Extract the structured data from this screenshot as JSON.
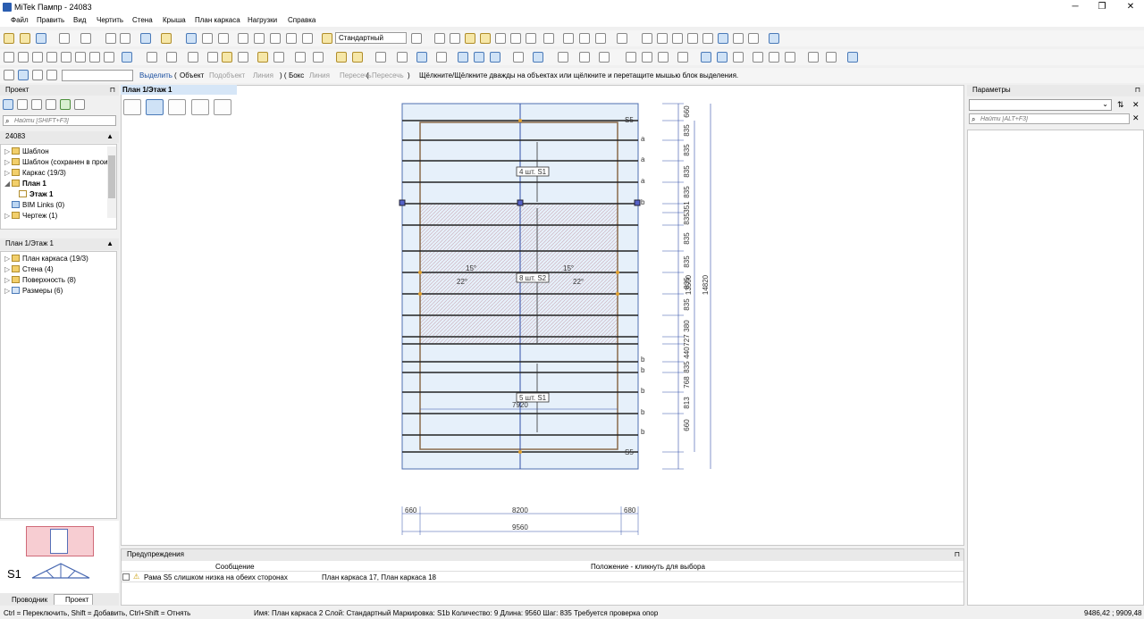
{
  "window": {
    "title": "MiTek Пампр - 24083",
    "minimize": "─",
    "maximize": "❐",
    "close": "✕"
  },
  "menu": [
    "Файл",
    "Править",
    "Вид",
    "Чертить",
    "Стена",
    "Крыша",
    "План каркаса",
    "Нагрузки",
    "Справка"
  ],
  "toolbar": {
    "layer_combo": "Стандартный"
  },
  "selection_bar": {
    "select_label": "Выделить",
    "object": "Объект",
    "subobject": "Подобъект",
    "line": "Линия",
    "box": "Бокс",
    "fence": "Линия",
    "crossing": "Пересечь",
    "between": "Пересечь",
    "hint": "Щёлкните/Щёлкните дважды на объектах или щёлкните и перетащите мышью блок выделения."
  },
  "project_panel": {
    "title": "Проект",
    "search_placeholder": "Найти [SHIFT+F3]",
    "project_name": "24083",
    "items": [
      {
        "label": "Шаблон",
        "level": 0
      },
      {
        "label": "Шаблон (сохранен в проиэ",
        "level": 0
      },
      {
        "label": "Каркас (19/3)",
        "level": 0
      },
      {
        "label": "План 1",
        "level": 0,
        "bold": true
      },
      {
        "label": "Этаж 1",
        "level": 1,
        "bold": true
      },
      {
        "label": "BIM Links (0)",
        "level": 0
      },
      {
        "label": "Чертеж (1)",
        "level": 0
      }
    ]
  },
  "floor_panel": {
    "title": "План 1/Этаж 1",
    "items": [
      {
        "label": "План каркаса (19/3)"
      },
      {
        "label": "Стена (4)"
      },
      {
        "label": "Поверхность (8)"
      },
      {
        "label": "Размеры (6)"
      }
    ]
  },
  "preview": {
    "label": "S1"
  },
  "left_tabs": {
    "explorer": "Проводник",
    "project": "Проект"
  },
  "doc_tab": "План 1/Этаж 1",
  "drawing": {
    "labels": {
      "s5_top": "S5",
      "s5_bottom": "S5",
      "group1": "4 шт. S1",
      "group2": "8 шт. S2",
      "group3": "5 шт. S1",
      "inner_width": "7920",
      "angle_left_top": "15°",
      "angle_left_bottom": "22°",
      "angle_right_top": "15°",
      "angle_right_bottom": "22°"
    },
    "row_tags_a": [
      "a",
      "a",
      "a",
      "b"
    ],
    "row_tags_b": [
      "b",
      "b",
      "b",
      "b",
      "b"
    ],
    "right_dims": [
      "660",
      "835",
      "835",
      "835",
      "835",
      "351",
      "835",
      "835",
      "835",
      "835",
      "835",
      "380",
      "727",
      "440",
      "835",
      "768",
      "813",
      "660"
    ],
    "dim_total_inner": "13500",
    "dim_total": "14820",
    "bottom_dims": [
      "660",
      "8200",
      "680"
    ],
    "bottom_total": "9560"
  },
  "params_panel": {
    "title": "Параметры",
    "search_placeholder": "Найти [ALT+F3]"
  },
  "warnings": {
    "title": "Предупреждения",
    "col_message": "Сообщение",
    "col_position": "Положение - кликнуть для выбора",
    "rows": [
      {
        "message": "Рама S5 слишком низка на обеих сторонах",
        "position": "План каркаса 17, План каркаса 18"
      }
    ]
  },
  "status": {
    "hint": "Ctrl = Переключить, Shift = Добавить, Ctrl+Shift = Отнять",
    "info": "Имя: План каркаса 2  Слой: Стандартный  Маркировка: S1b     Количество: 9  Длина: 9560  Шаг: 835   Требуется проверка опор",
    "coords": "9486,42 ; 9909,48"
  }
}
